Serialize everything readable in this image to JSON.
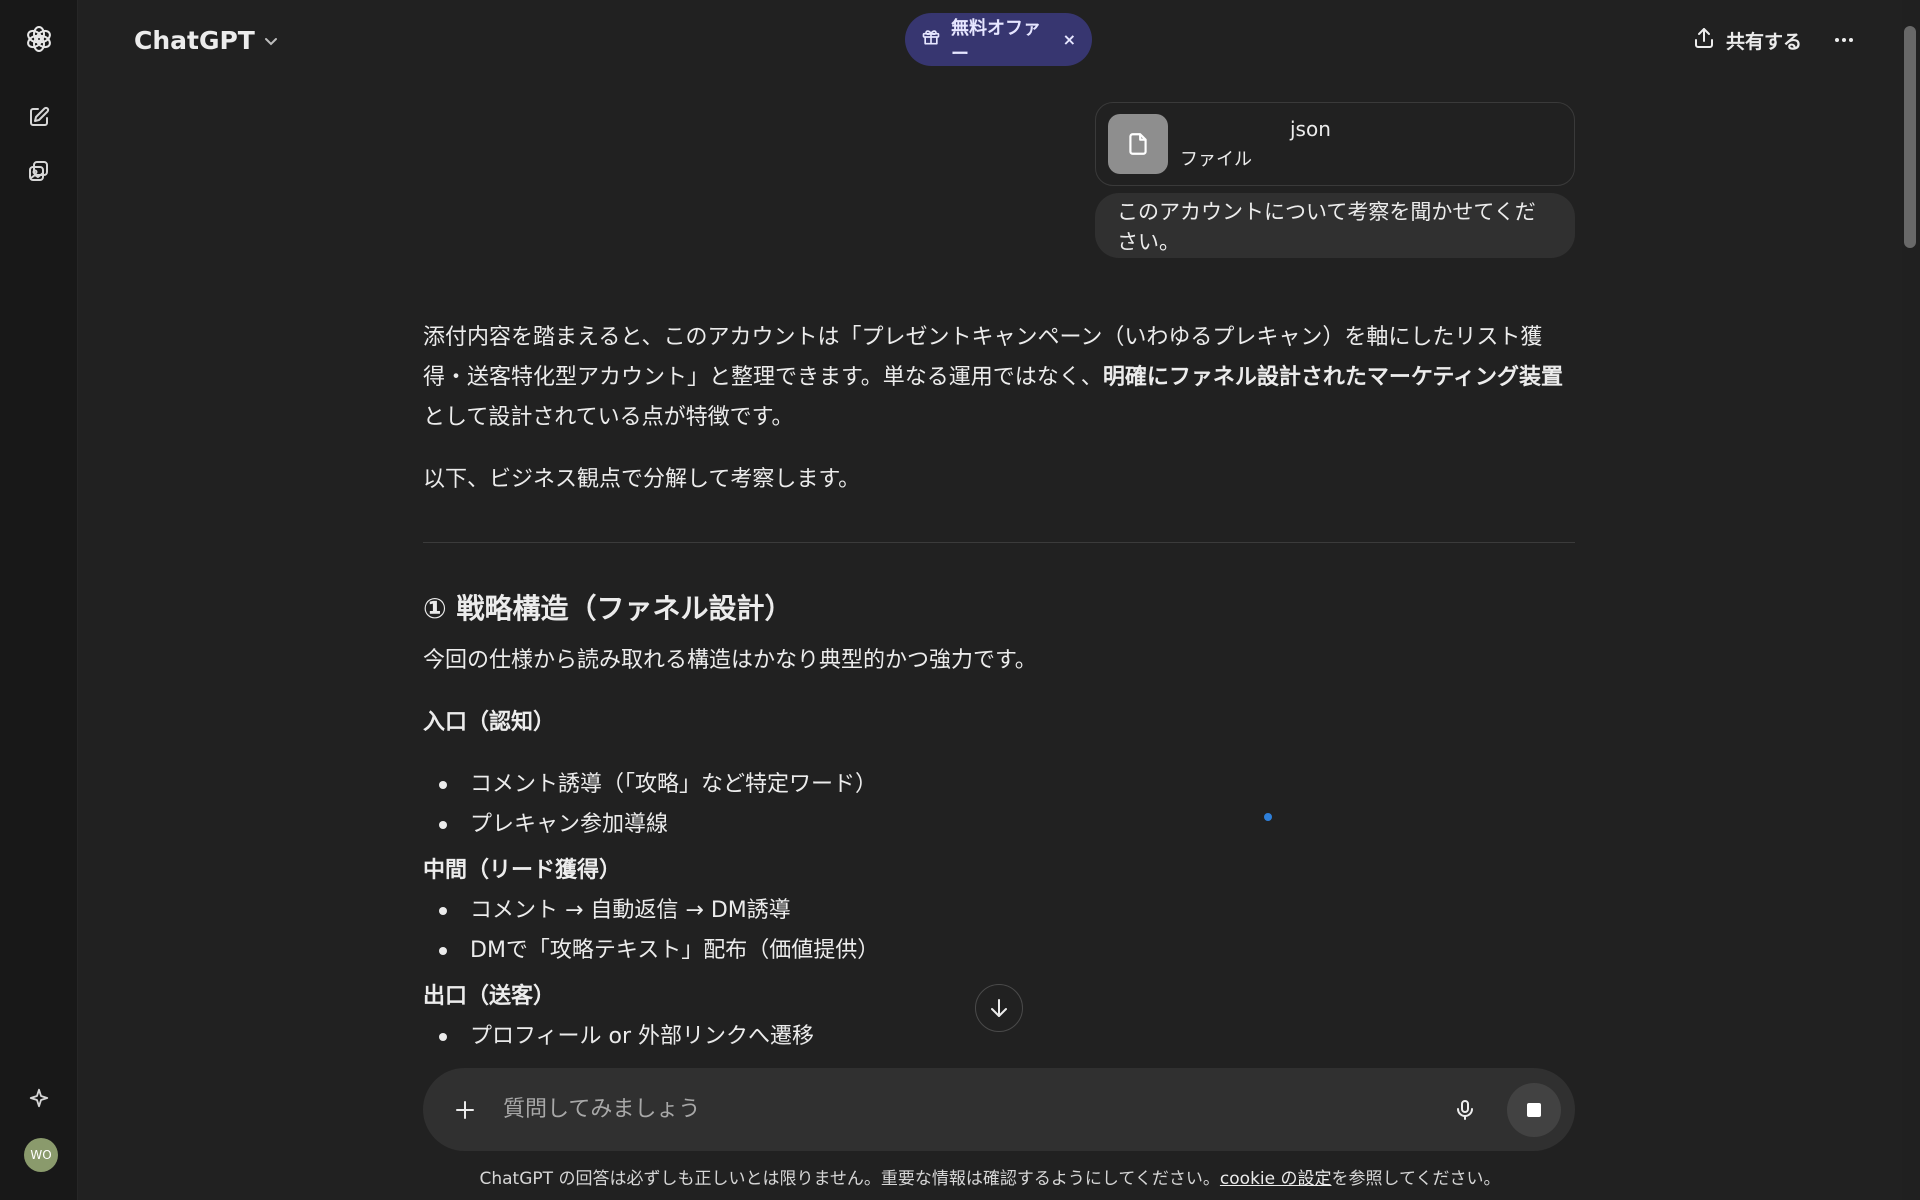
{
  "header": {
    "model": "ChatGPT",
    "offer_label": "無料オファー",
    "offer_close": "×",
    "share_label": "共有する"
  },
  "attachment": {
    "name": "json",
    "type": "ファイル"
  },
  "user_message": "このアカウントについて考察を聞かせてください。",
  "answer": {
    "intro_before": "添付内容を踏まえると、このアカウントは「プレゼントキャンペーン（いわゆるプレキャン）を軸にしたリスト獲得・送客特化型アカウント」と整理できます。単なる運用ではなく、",
    "intro_bold": "明確にファネル設計されたマーケティング装置",
    "intro_after": "として設計されている点が特徴です。",
    "intro2": "以下、ビジネス観点で分解して考察します。",
    "section_title": "① 戦略構造（ファネル設計）",
    "section_lead": "今回の仕様から読み取れる構造はかなり典型的かつ強力です。",
    "stages": [
      {
        "title": "入口（認知）",
        "items": [
          "コメント誘導（「攻略」など特定ワード）",
          "プレキャン参加導線"
        ]
      },
      {
        "title": "中間（リード獲得）",
        "items": [
          "コメント → 自動返信 → DM誘導",
          "DMで「攻略テキスト」配布（価値提供）"
        ]
      },
      {
        "title": "出口（送客）",
        "items": [
          "プロフィール or 外部リンクへ遷移"
        ]
      }
    ]
  },
  "composer": {
    "placeholder": "質問してみましょう"
  },
  "footer": {
    "text_before": "ChatGPT の回答は必ずしも正しいとは限りません。重要な情報は確認するようにしてください。",
    "link": "cookie の設定",
    "text_after": "を参照してください。"
  },
  "user": {
    "initials": "WO"
  },
  "icons": {
    "logo": "openai-logo-icon",
    "new_chat": "new-chat-icon",
    "images": "images-icon",
    "sparkle": "sparkle-icon",
    "gift": "gift-icon",
    "share": "share-icon",
    "more": "more-icon",
    "file": "file-icon",
    "arrow_down": "arrow-down-icon",
    "plus": "plus-icon",
    "mic": "mic-icon",
    "stop": "stop-icon"
  },
  "colors": {
    "background": "#212121",
    "sidebar": "#181818",
    "bubble": "#303030",
    "offer": "#373670",
    "accent_dot": "#2e7fd9"
  }
}
